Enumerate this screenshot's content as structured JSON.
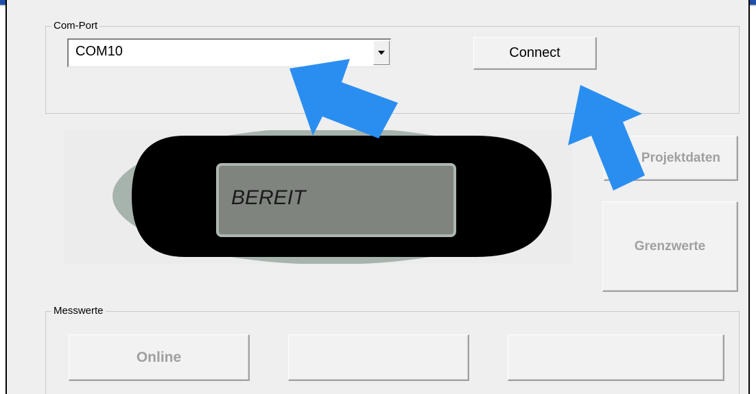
{
  "com_port": {
    "group_label": "Com-Port",
    "selected_port": "COM10",
    "connect_label": "Connect"
  },
  "display": {
    "status_text": "BEREIT"
  },
  "side_buttons": {
    "projektdaten_label": "Projektdaten",
    "grenzwerte_label": "Grenzwerte"
  },
  "messwerte": {
    "group_label": "Messwerte",
    "online_label": "Online",
    "button2_label": "",
    "button3_label": ""
  },
  "colors": {
    "annotation_arrow": "#2a8ef0",
    "lcd_background": "#7f857e",
    "device_body": "#000000",
    "title_bar": "#1f4fa8"
  }
}
